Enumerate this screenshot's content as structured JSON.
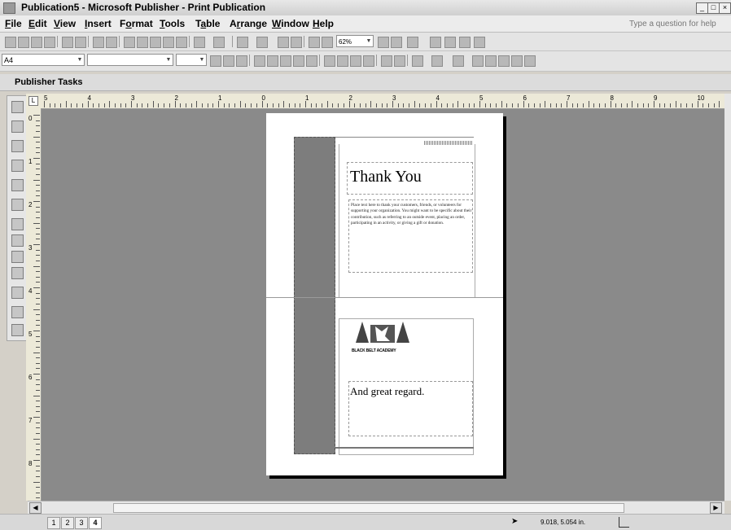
{
  "window": {
    "title": "Publication5 - Microsoft Publisher - Print Publication",
    "help_placeholder": "Type a question for help"
  },
  "menu": [
    {
      "label": "File",
      "accel": "F",
      "rest": "ile"
    },
    {
      "label": "Edit",
      "accel": "E",
      "rest": "dit"
    },
    {
      "label": "View",
      "accel": "V",
      "rest": "iew"
    },
    {
      "label": "Insert",
      "accel": "I",
      "rest": "nsert"
    },
    {
      "label": "Format",
      "accel": "o",
      "rest": "F rmat"
    },
    {
      "label": "Tools",
      "accel": "T",
      "rest": "ools"
    },
    {
      "label": "Table",
      "accel": "a",
      "rest": "T ble"
    },
    {
      "label": "Arrange",
      "accel": "r",
      "rest": "A range"
    },
    {
      "label": "Window",
      "accel": "W",
      "rest": "indow"
    },
    {
      "label": "Help",
      "accel": "H",
      "rest": "elp"
    }
  ],
  "toolbar": {
    "zoom": "62%",
    "style_box": "A4"
  },
  "taskpane": {
    "label": "Publisher Tasks"
  },
  "ruler": {
    "h_numbers": [
      "5",
      "4",
      "3",
      "2",
      "1",
      "0",
      "1",
      "2",
      "3",
      "4",
      "5",
      "6",
      "7",
      "8",
      "9",
      "10"
    ],
    "v_numbers": [
      "0",
      "1",
      "2",
      "3",
      "4",
      "5",
      "6",
      "7",
      "8"
    ]
  },
  "card": {
    "heading": "Thank You",
    "body": "Place text here to thank your customers, friends, or volunteers for supporting your organization. You might want to be specific about their contribution, such as referring to an outside event, placing an order, participating in an activity, or giving a gift or donation.",
    "logo_text": "BLACK BELT ACADEMY",
    "closing": "And great regard."
  },
  "status": {
    "pages": [
      "1",
      "2",
      "3",
      "4"
    ],
    "active_page": "4",
    "coordinates": "9.018, 5.054 in."
  }
}
